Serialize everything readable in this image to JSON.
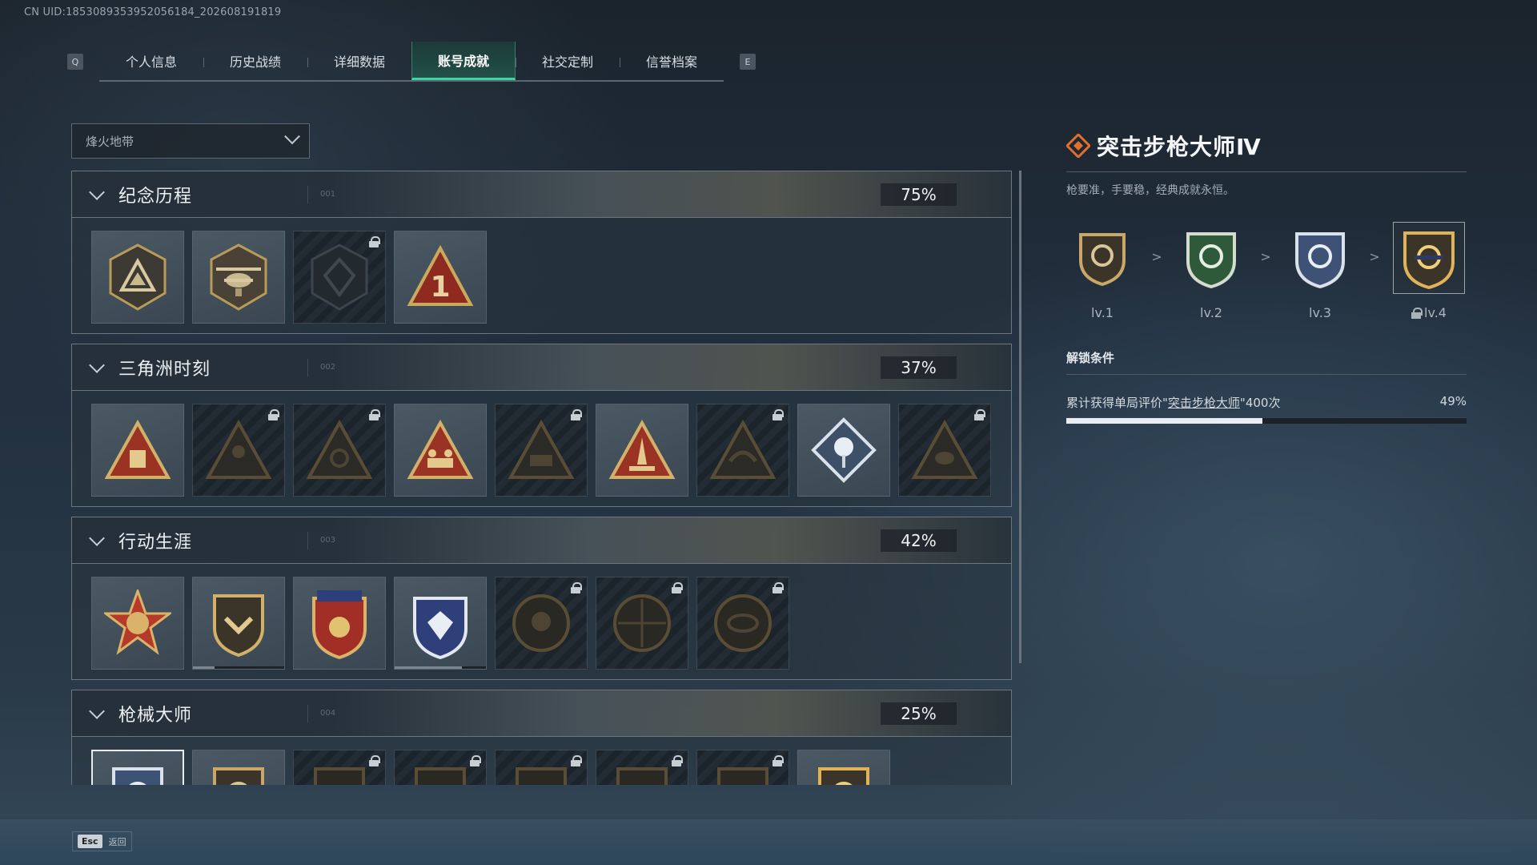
{
  "uid": "CN UID:1853089353952056184_202608191819",
  "nav": {
    "left_key": "Q",
    "right_key": "E",
    "tabs": [
      {
        "label": "个人信息"
      },
      {
        "label": "历史战绩"
      },
      {
        "label": "详细数据"
      },
      {
        "label": "账号成就"
      },
      {
        "label": "社交定制"
      },
      {
        "label": "信誉档案"
      }
    ],
    "active_tab": "账号成就"
  },
  "mode_select": {
    "value": "烽火地带"
  },
  "sections": [
    {
      "name": "纪念历程",
      "num": "001",
      "percent": "75%"
    },
    {
      "name": "三角洲时刻",
      "num": "002",
      "percent": "37%"
    },
    {
      "name": "行动生涯",
      "num": "003",
      "percent": "42%"
    },
    {
      "name": "枪械大师",
      "num": "004",
      "percent": "25%"
    }
  ],
  "detail": {
    "title": "突击步枪大师Ⅳ",
    "description": "枪要准，手要稳，经典成就永恒。",
    "levels": [
      {
        "label": "lv.1"
      },
      {
        "label": "lv.2"
      },
      {
        "label": "lv.3"
      },
      {
        "label": "lv.4"
      }
    ],
    "level_separator": ">",
    "unlock_title": "解锁条件",
    "condition_prefix": "累计获得单局评价\"",
    "condition_link": "突击步枪大师",
    "condition_suffix": "\"400次",
    "progress_text": "49%",
    "progress_fraction": 0.49
  },
  "footer": {
    "esc_key": "Esc",
    "back_label": "返回"
  },
  "colors": {
    "accent": "#3bd7a3",
    "title_icon": "#e0702a",
    "gold": "#b89a5a",
    "red": "#b53a2a"
  }
}
